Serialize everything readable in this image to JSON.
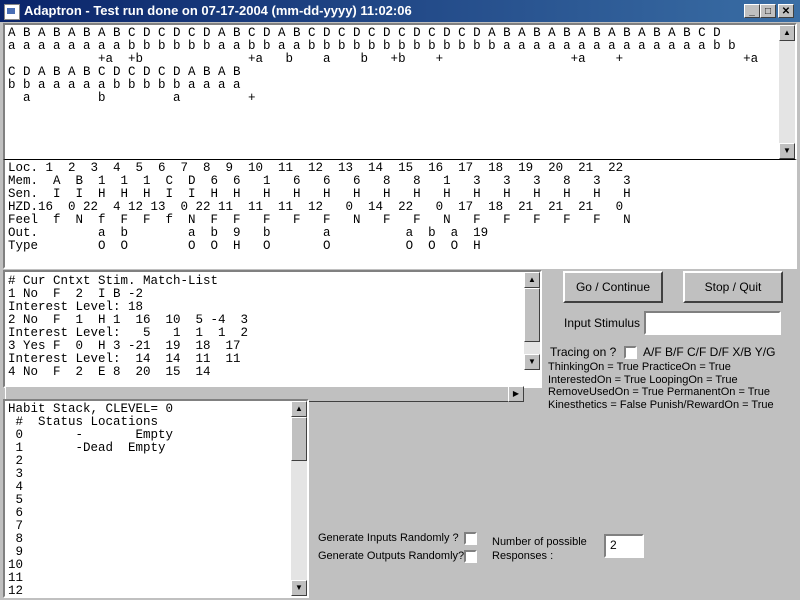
{
  "window": {
    "title": "Adaptron - Test run done on 07-17-2004 (mm-dd-yyyy) 11:02:06",
    "minimize": "_",
    "maximize": "□",
    "close": "✕"
  },
  "stimulus_panel": {
    "lines": "A B A B A B A B C D C D C D A B C D A B C D C D C D C D C D C D A B A B A B A B A B A B A B C D\na a a a a a a a b b b b b b a a b b a a b b b b b b b b b b b b b a a a a a a a a a a a a a a b b\n            +a  +b              +a   b    a    b   +b    +                 +a    +                +a     +b\nC D A B A B C D C D C D A B A B\nb b a a a a a b b b b b a a a a\n  a         b         a         +"
  },
  "memory_panel": {
    "lines": "Loc. 1  2  3  4  5  6  7  8  9  10  11  12  13  14  15  16  17  18  19  20  21  22\nMem.  A  B  1  1  1  C  D  6  6   1   6   6   6   8   8   1   3   3   3   8   3   3\nSen.  I  I  H  H  H  I  I  H  H   H   H   H   H   H   H   H   H   H   H   H   H   H\nHZD.16  0 22  4 12 13  0 22 11  11  11  12   0  14  22   0  17  18  21  21  21   0\nFeel  f  N  f  F  F  f  N  F  F   F   F   F   N   F   F   N   F   F   F   F   F   N\nOut.        a  b        a  b  9   b       a          a  b  a  19\nType        O  O        O  O  H   O       O          O  O  O  H"
  },
  "context_panel": {
    "lines": "# Cur Cntxt Stim. Match-List\n1 No  F  2  I B -2\nInterest Level: 18\n2 No  F  1  H 1  16  10  5 -4  3\nInterest Level:   5   1  1  1  2\n3 Yes F  0  H 3 -21  19  18  17\nInterest Level:  14  14  11  11\n4 No  F  2  E 8  20  15  14"
  },
  "habit_panel": {
    "lines": "Habit Stack, CLEVEL= 0\n #  Status Locations\n 0       -       Empty\n 1       -Dead  Empty\n 2\n 3\n 4\n 5\n 6\n 7\n 8\n 9\n10\n11\n12"
  },
  "controls": {
    "go_label": "Go / Continue",
    "stop_label": "Stop / Quit",
    "input_stimulus_label": "Input Stimulus :",
    "input_stimulus_value": "",
    "tracing_label": "Tracing on ?",
    "tracing_options": "A/F  B/F  C/F  D/F  X/B  Y/G",
    "status_lines": [
      "ThinkingOn = True PracticeOn = True",
      "InterestedOn = True LoopingOn = True",
      "RemoveUsedOn = True PermanentOn = True",
      "Kinesthetics = False Punish/RewardOn = True"
    ],
    "gen_inputs_label": "Generate Inputs Randomly ?",
    "gen_outputs_label": "Generate Outputs Randomly?",
    "num_responses_label_1": "Number of possible",
    "num_responses_label_2": "Responses :",
    "num_responses_value": "2"
  },
  "scroll_glyphs": {
    "up": "▲",
    "down": "▼",
    "left": "◀",
    "right": "▶"
  }
}
